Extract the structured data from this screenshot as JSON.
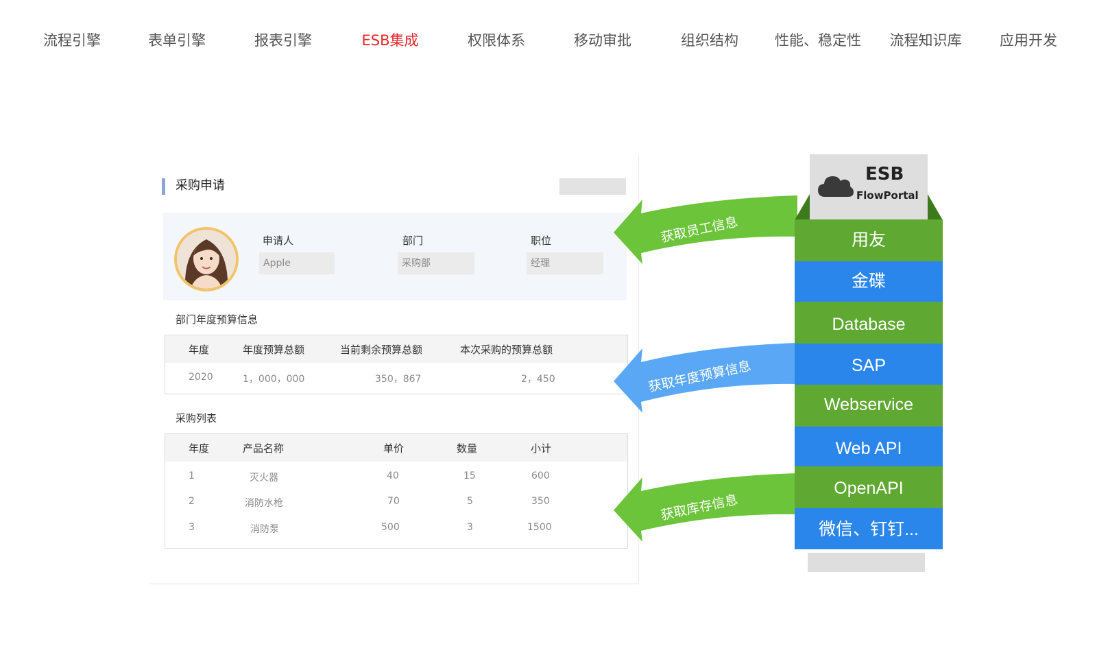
{
  "nav": {
    "items": [
      "流程引擎",
      "表单引擎",
      "报表引擎",
      "ESB集成",
      "权限体系",
      "移动审批",
      "组织结构",
      "性能、稳定性",
      "流程知识库",
      "应用开发"
    ],
    "active_index": 3
  },
  "form": {
    "title": "采购申请",
    "applicant": {
      "labels": [
        "申请人",
        "部门",
        "职位"
      ],
      "values": [
        "Apple",
        "采购部",
        "经理"
      ]
    },
    "budget": {
      "title": "部门年度预算信息",
      "headers": [
        "年度",
        "年度预算总额",
        "当前剩余预算总额",
        "本次采购的预算总额"
      ],
      "row": [
        "2020",
        "1，000，000",
        "350，867",
        "2，450"
      ]
    },
    "purchase": {
      "title": "采购列表",
      "headers": [
        "年度",
        "产品名称",
        "单价",
        "数量",
        "小计"
      ],
      "rows": [
        [
          "1",
          "灭火器",
          "40",
          "15",
          "600"
        ],
        [
          "2",
          "消防水枪",
          "70",
          "5",
          "350"
        ],
        [
          "3",
          "消防泵",
          "500",
          "3",
          "1500"
        ]
      ]
    }
  },
  "arrows": [
    {
      "label": "获取员工信息",
      "color": "#6cc43a"
    },
    {
      "label": "获取年度预算信息",
      "color": "#5aa8f5"
    },
    {
      "label": "获取库存信息",
      "color": "#6cc43a"
    }
  ],
  "esb": {
    "title": "ESB",
    "subtitle": "FlowPortal",
    "cloud_icon": "cloud-icon",
    "layers": [
      {
        "label": "用友",
        "color": "green"
      },
      {
        "label": "金碟",
        "color": "blue"
      },
      {
        "label": "Database",
        "color": "green"
      },
      {
        "label": "SAP",
        "color": "blue"
      },
      {
        "label": "Webservice",
        "color": "green"
      },
      {
        "label": "Web API",
        "color": "blue"
      },
      {
        "label": "OpenAPI",
        "color": "green"
      },
      {
        "label": "微信、钉钉...",
        "color": "blue"
      }
    ]
  },
  "colors": {
    "nav_active": "#e8262b",
    "green": "#5fa832",
    "blue": "#2b86ec",
    "arrow_green": "#6cc43a",
    "arrow_blue": "#5aa8f5"
  }
}
